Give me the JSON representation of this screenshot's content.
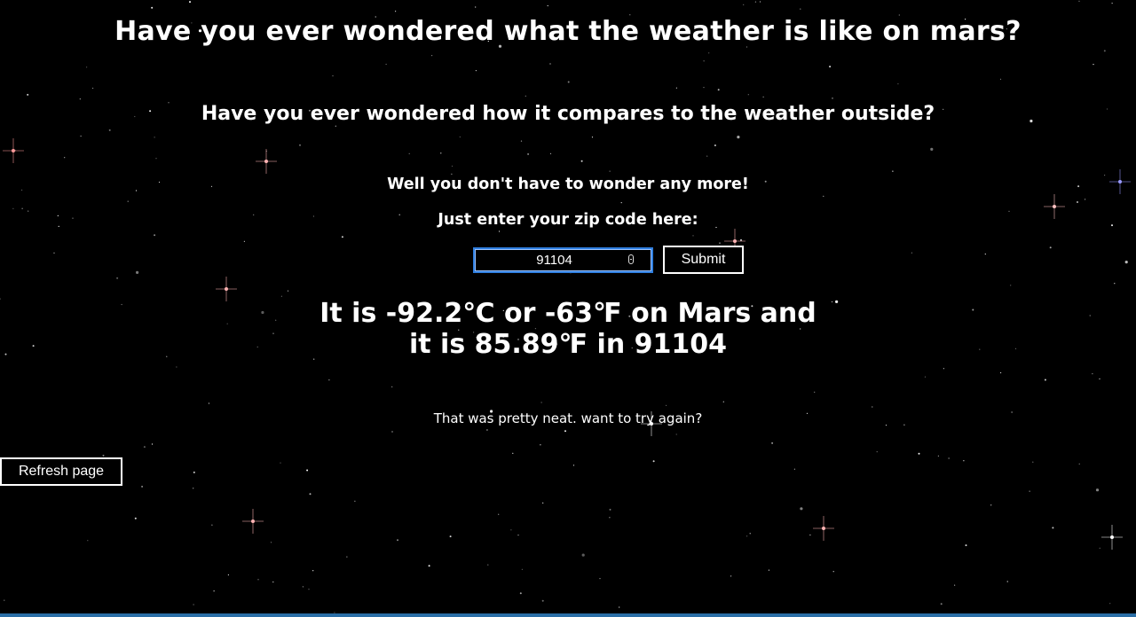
{
  "header": {
    "title": "Have you ever wondered what the weather is like on mars?",
    "subtitle": "Have you ever wondered how it compares to the weather outside?"
  },
  "intro": {
    "line1": "Well you don't have to wonder any more!",
    "line2": "Just enter your zip code here:"
  },
  "form": {
    "zip_value": "91104",
    "submit_label": "Submit"
  },
  "result": {
    "line1": "It is -92.2℃ or -63℉ on Mars and",
    "line2": "it is 85.89℉ in 91104",
    "again_text": "That was pretty neat. want to try again?"
  },
  "controls": {
    "refresh_label": "Refresh page"
  },
  "colors": {
    "background": "#000000",
    "text": "#ffffff",
    "input_focus_border": "#2f7fe0",
    "bottom_bar": "#2a6ea6"
  },
  "icons": {
    "input_spinner": "number-spinner-icon"
  }
}
